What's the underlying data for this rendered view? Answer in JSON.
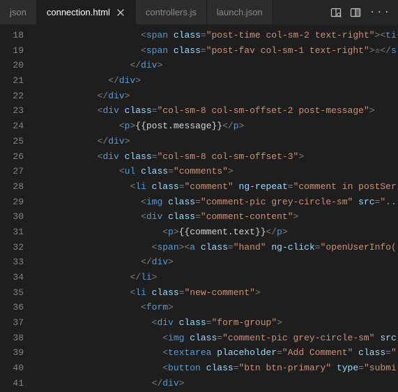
{
  "tabs": {
    "left_partial": "json",
    "active": "connection.html",
    "t2": "controllers.js",
    "t3_partial": "launch.json"
  },
  "gutter": [
    "18",
    "19",
    "20",
    "21",
    "22",
    "23",
    "24",
    "25",
    "26",
    "27",
    "28",
    "29",
    "30",
    "31",
    "32",
    "33",
    "34",
    "35",
    "36",
    "37",
    "38",
    "39",
    "40",
    "41"
  ],
  "code": {
    "lines": [
      {
        "indent": 10,
        "tokens": [
          [
            "p",
            "<"
          ],
          [
            "tag",
            "span"
          ],
          [
            "txt",
            " "
          ],
          [
            "attr",
            "class"
          ],
          [
            "p",
            "="
          ],
          [
            "str",
            "\"post-time col-sm-2 text-right\""
          ],
          [
            "p",
            "><"
          ],
          [
            "tag",
            "ti"
          ]
        ]
      },
      {
        "indent": 10,
        "tokens": [
          [
            "p",
            "<"
          ],
          [
            "tag",
            "span"
          ],
          [
            "txt",
            " "
          ],
          [
            "attr",
            "class"
          ],
          [
            "p",
            "="
          ],
          [
            "str",
            "\"post-fav col-sm-1 text-right\""
          ],
          [
            "p",
            ">"
          ],
          [
            "txt",
            "☆"
          ],
          [
            "p",
            "</"
          ],
          [
            "tag",
            "s"
          ]
        ]
      },
      {
        "indent": 9,
        "tokens": [
          [
            "p",
            "</"
          ],
          [
            "tag",
            "div"
          ],
          [
            "p",
            ">"
          ]
        ]
      },
      {
        "indent": 7,
        "tokens": [
          [
            "p",
            "</"
          ],
          [
            "tag",
            "div"
          ],
          [
            "p",
            ">"
          ]
        ]
      },
      {
        "indent": 6,
        "tokens": [
          [
            "p",
            "</"
          ],
          [
            "tag",
            "div"
          ],
          [
            "p",
            ">"
          ]
        ]
      },
      {
        "indent": 6,
        "tokens": [
          [
            "p",
            "<"
          ],
          [
            "tag",
            "div"
          ],
          [
            "txt",
            " "
          ],
          [
            "attr",
            "class"
          ],
          [
            "p",
            "="
          ],
          [
            "str",
            "\"col-sm-8 col-sm-offset-2 post-message\""
          ],
          [
            "p",
            ">"
          ]
        ]
      },
      {
        "indent": 8,
        "tokens": [
          [
            "p",
            "<"
          ],
          [
            "tag",
            "p"
          ],
          [
            "p",
            ">"
          ],
          [
            "txt",
            "{{post.message}}"
          ],
          [
            "p",
            "</"
          ],
          [
            "tag",
            "p"
          ],
          [
            "p",
            ">"
          ]
        ]
      },
      {
        "indent": 6,
        "tokens": [
          [
            "p",
            "</"
          ],
          [
            "tag",
            "div"
          ],
          [
            "p",
            ">"
          ]
        ]
      },
      {
        "indent": 6,
        "tokens": [
          [
            "p",
            "<"
          ],
          [
            "tag",
            "div"
          ],
          [
            "txt",
            " "
          ],
          [
            "attr",
            "class"
          ],
          [
            "p",
            "="
          ],
          [
            "str",
            "\"col-sm-8 col-sm-offset-3\""
          ],
          [
            "p",
            ">"
          ]
        ]
      },
      {
        "indent": 8,
        "tokens": [
          [
            "p",
            "<"
          ],
          [
            "tag",
            "ul"
          ],
          [
            "txt",
            " "
          ],
          [
            "attr",
            "class"
          ],
          [
            "p",
            "="
          ],
          [
            "str",
            "\"comments\""
          ],
          [
            "p",
            ">"
          ]
        ]
      },
      {
        "indent": 9,
        "tokens": [
          [
            "p",
            "<"
          ],
          [
            "tag",
            "li"
          ],
          [
            "txt",
            " "
          ],
          [
            "attr",
            "class"
          ],
          [
            "p",
            "="
          ],
          [
            "str",
            "\"comment\""
          ],
          [
            "txt",
            " "
          ],
          [
            "attr",
            "ng-repeat"
          ],
          [
            "p",
            "="
          ],
          [
            "str",
            "\"comment in postSer"
          ]
        ]
      },
      {
        "indent": 10,
        "tokens": [
          [
            "p",
            "<"
          ],
          [
            "tag",
            "img"
          ],
          [
            "txt",
            " "
          ],
          [
            "attr",
            "class"
          ],
          [
            "p",
            "="
          ],
          [
            "str",
            "\"comment-pic grey-circle-sm\""
          ],
          [
            "txt",
            " "
          ],
          [
            "attr",
            "src"
          ],
          [
            "p",
            "="
          ],
          [
            "str",
            "\"..."
          ]
        ]
      },
      {
        "indent": 10,
        "tokens": [
          [
            "p",
            "<"
          ],
          [
            "tag",
            "div"
          ],
          [
            "txt",
            " "
          ],
          [
            "attr",
            "class"
          ],
          [
            "p",
            "="
          ],
          [
            "str",
            "\"comment-content\""
          ],
          [
            "p",
            ">"
          ]
        ]
      },
      {
        "indent": 12,
        "tokens": [
          [
            "p",
            "<"
          ],
          [
            "tag",
            "p"
          ],
          [
            "p",
            ">"
          ],
          [
            "txt",
            "{{comment.text}}"
          ],
          [
            "p",
            "</"
          ],
          [
            "tag",
            "p"
          ],
          [
            "p",
            ">"
          ]
        ]
      },
      {
        "indent": 11,
        "tokens": [
          [
            "p",
            "<"
          ],
          [
            "tag",
            "span"
          ],
          [
            "p",
            "><"
          ],
          [
            "tag",
            "a"
          ],
          [
            "txt",
            " "
          ],
          [
            "attr",
            "class"
          ],
          [
            "p",
            "="
          ],
          [
            "str",
            "\"hand\""
          ],
          [
            "txt",
            " "
          ],
          [
            "attr",
            "ng-click"
          ],
          [
            "p",
            "="
          ],
          [
            "str",
            "\"openUserInfo("
          ]
        ]
      },
      {
        "indent": 10,
        "tokens": [
          [
            "p",
            "</"
          ],
          [
            "tag",
            "div"
          ],
          [
            "p",
            ">"
          ]
        ]
      },
      {
        "indent": 9,
        "tokens": [
          [
            "p",
            "</"
          ],
          [
            "tag",
            "li"
          ],
          [
            "p",
            ">"
          ]
        ]
      },
      {
        "indent": 9,
        "tokens": [
          [
            "p",
            "<"
          ],
          [
            "tag",
            "li"
          ],
          [
            "txt",
            " "
          ],
          [
            "attr",
            "class"
          ],
          [
            "p",
            "="
          ],
          [
            "str",
            "\"new-comment\""
          ],
          [
            "p",
            ">"
          ]
        ]
      },
      {
        "indent": 10,
        "tokens": [
          [
            "p",
            "<"
          ],
          [
            "tag",
            "form"
          ],
          [
            "p",
            ">"
          ]
        ]
      },
      {
        "indent": 11,
        "tokens": [
          [
            "p",
            "<"
          ],
          [
            "tag",
            "div"
          ],
          [
            "txt",
            " "
          ],
          [
            "attr",
            "class"
          ],
          [
            "p",
            "="
          ],
          [
            "str",
            "\"form-group\""
          ],
          [
            "p",
            ">"
          ]
        ]
      },
      {
        "indent": 12,
        "tokens": [
          [
            "p",
            "<"
          ],
          [
            "tag",
            "img"
          ],
          [
            "txt",
            " "
          ],
          [
            "attr",
            "class"
          ],
          [
            "p",
            "="
          ],
          [
            "str",
            "\"comment-pic grey-circle-sm\""
          ],
          [
            "txt",
            " "
          ],
          [
            "attr",
            "src"
          ]
        ]
      },
      {
        "indent": 12,
        "tokens": [
          [
            "p",
            "<"
          ],
          [
            "tag",
            "textarea"
          ],
          [
            "txt",
            " "
          ],
          [
            "attr",
            "placeholder"
          ],
          [
            "p",
            "="
          ],
          [
            "str",
            "\"Add Comment\""
          ],
          [
            "txt",
            " "
          ],
          [
            "attr",
            "class"
          ],
          [
            "p",
            "="
          ],
          [
            "str",
            "\""
          ]
        ]
      },
      {
        "indent": 12,
        "tokens": [
          [
            "p",
            "<"
          ],
          [
            "tag",
            "button"
          ],
          [
            "txt",
            " "
          ],
          [
            "attr",
            "class"
          ],
          [
            "p",
            "="
          ],
          [
            "str",
            "\"btn btn-primary\""
          ],
          [
            "txt",
            " "
          ],
          [
            "attr",
            "type"
          ],
          [
            "p",
            "="
          ],
          [
            "str",
            "\"submi"
          ]
        ]
      },
      {
        "indent": 11,
        "tokens": [
          [
            "p",
            "</"
          ],
          [
            "tag",
            "div"
          ],
          [
            "p",
            ">"
          ]
        ]
      }
    ]
  }
}
